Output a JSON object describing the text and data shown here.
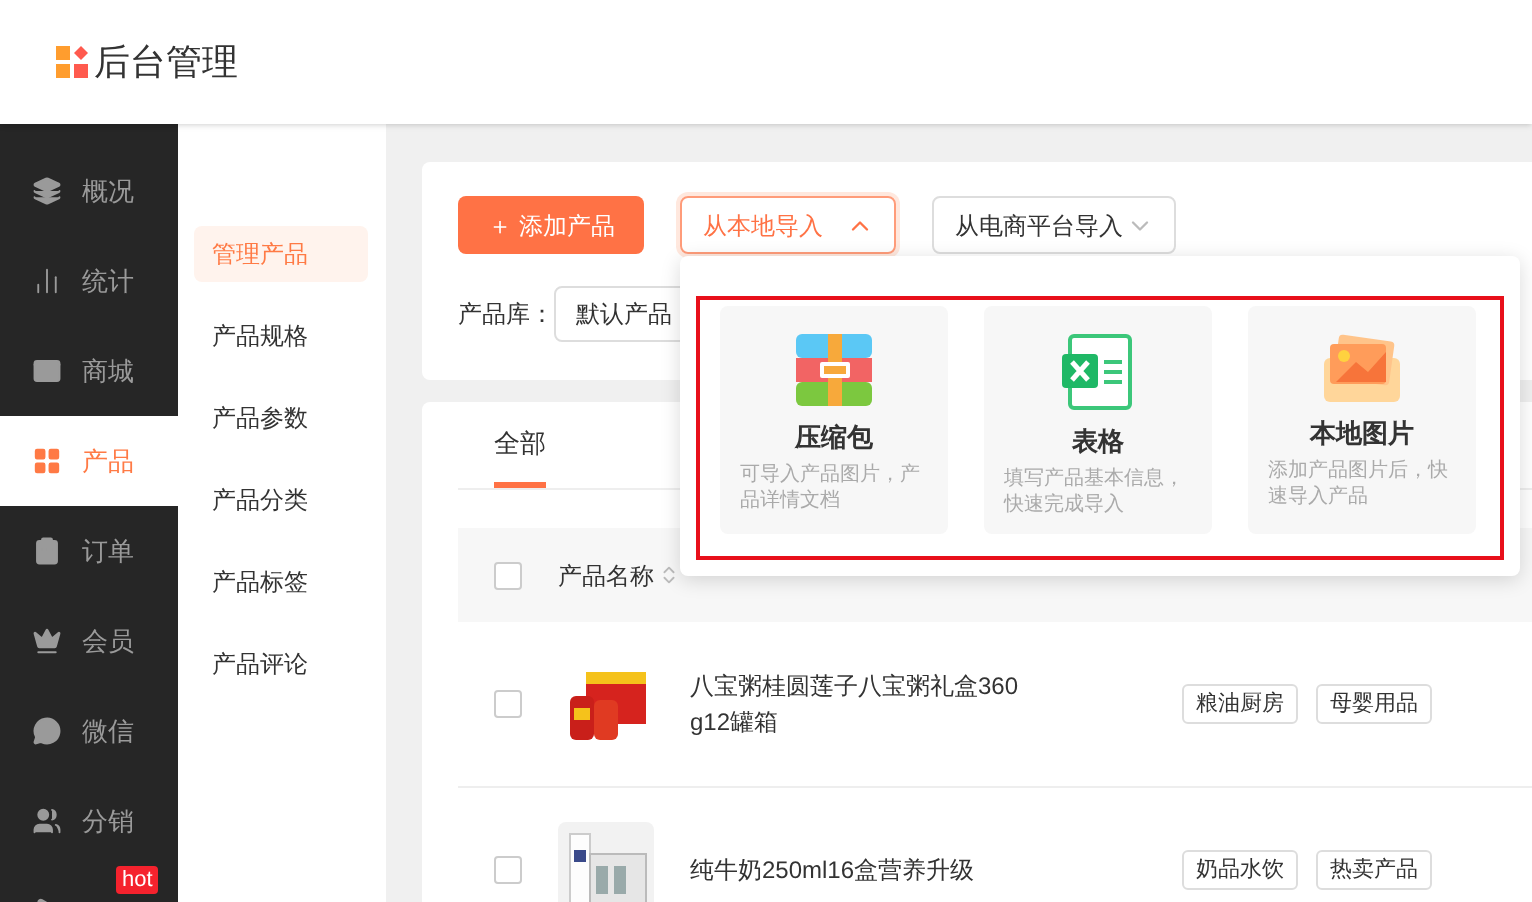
{
  "header": {
    "title": "后台管理"
  },
  "sidebar": {
    "items": [
      {
        "label": "概况",
        "selected": false
      },
      {
        "label": "统计",
        "selected": false
      },
      {
        "label": "商城",
        "selected": false
      },
      {
        "label": "产品",
        "selected": true
      },
      {
        "label": "订单",
        "selected": false
      },
      {
        "label": "会员",
        "selected": false
      },
      {
        "label": "微信",
        "selected": false
      },
      {
        "label": "分销",
        "selected": false
      },
      {
        "selected": false,
        "badge": "hot"
      }
    ]
  },
  "subnav": {
    "items": [
      {
        "label": "管理产品",
        "selected": true
      },
      {
        "label": "产品规格",
        "selected": false
      },
      {
        "label": "产品参数",
        "selected": false
      },
      {
        "label": "产品分类",
        "selected": false
      },
      {
        "label": "产品标签",
        "selected": false
      },
      {
        "label": "产品评论",
        "selected": false
      }
    ]
  },
  "toolbar": {
    "add_button": "＋ 添加产品",
    "local_import": {
      "label": "从本地导入",
      "expanded": true
    },
    "platform_import": {
      "label": "从电商平台导入",
      "expanded": false
    },
    "library_label": "产品库：",
    "library_value": "默认产品"
  },
  "import_menu": {
    "options": [
      {
        "kind": "zip",
        "title": "压缩包",
        "description": "可导入产品图片，产品详情文档"
      },
      {
        "kind": "sheet",
        "title": "表格",
        "description": "填写产品基本信息，快速完成导入"
      },
      {
        "title": "本地图片",
        "description": "添加产品图片后，快速导入产品"
      }
    ]
  },
  "tabs": [
    {
      "label": "全部",
      "selected": true
    }
  ],
  "table": {
    "select_all_checked": false,
    "columns": [
      "产品名称"
    ],
    "rows": [
      {
        "checked": false,
        "name": "八宝粥桂圆莲子八宝粥礼盒360g12罐箱",
        "tags": [
          "粮油厨房",
          "母婴用品"
        ]
      },
      {
        "checked": false,
        "name": "纯牛奶250ml16盒营养升级",
        "tags": [
          "奶品水饮",
          "热卖产品"
        ]
      }
    ]
  }
}
